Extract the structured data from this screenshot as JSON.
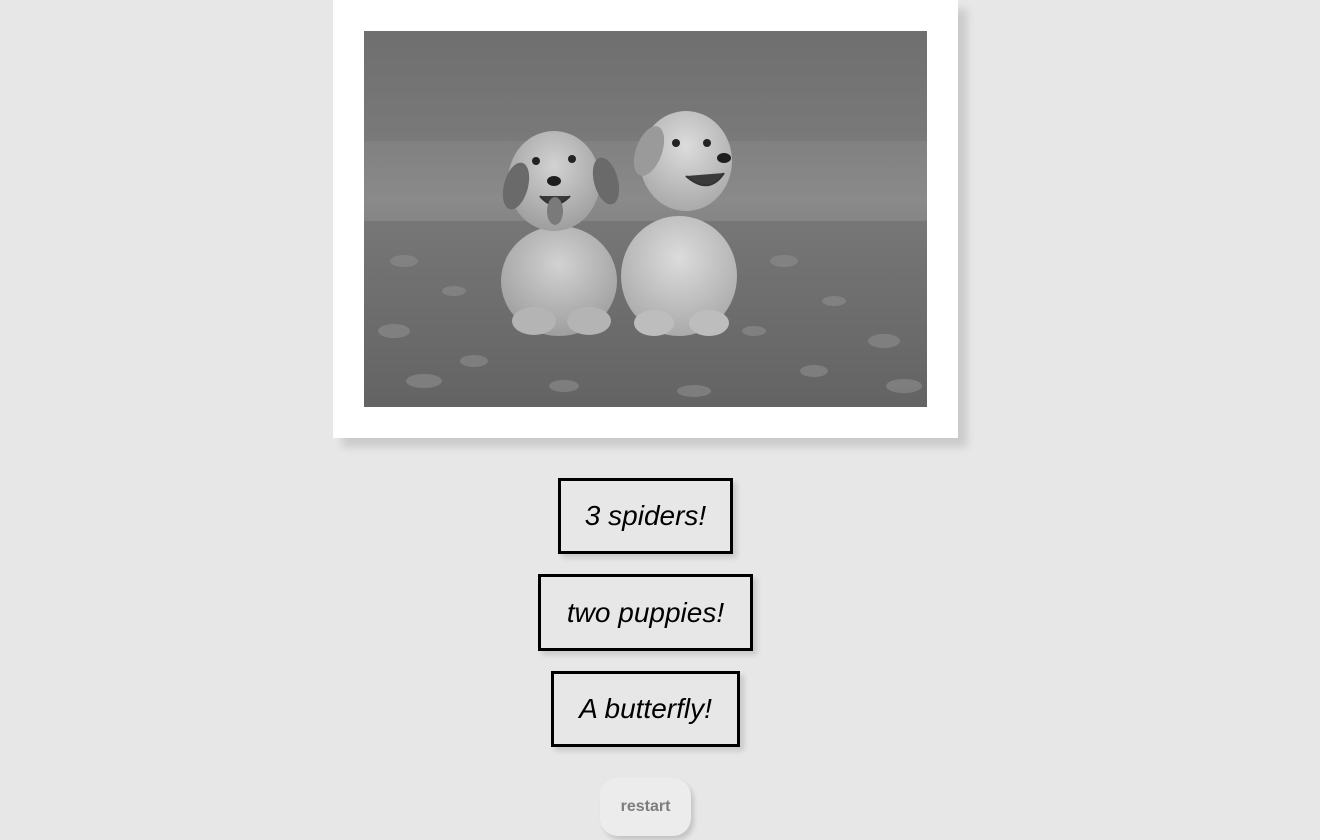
{
  "quiz": {
    "image_icon": "two-puppies-photo",
    "choices": [
      {
        "label": "3 spiders!"
      },
      {
        "label": "two puppies!"
      },
      {
        "label": "A butterfly!"
      }
    ],
    "restart_label": "restart"
  },
  "colors": {
    "background": "#e7e7e7",
    "card": "#ffffff",
    "choice_border": "#000000",
    "restart_bg": "#ececec",
    "restart_text": "#7d7d7d"
  }
}
